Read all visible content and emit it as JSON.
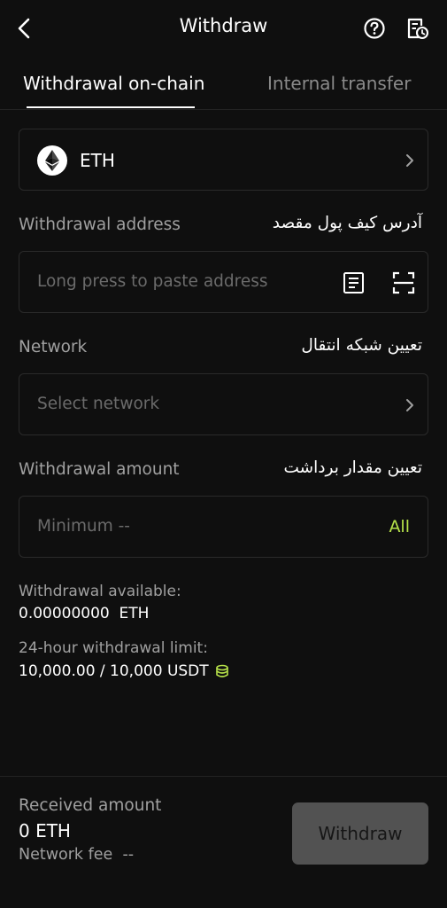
{
  "header": {
    "title": "Withdraw",
    "back_icon": "chevron-left-icon",
    "help_icon": "question-circle-icon",
    "record_icon": "history-document-icon"
  },
  "tabs": [
    {
      "label": "Withdrawal on-chain",
      "active": true
    },
    {
      "label": "Internal transfer",
      "active": false
    }
  ],
  "coin": {
    "name": "ETH",
    "icon": "ethereum-logo-icon"
  },
  "address": {
    "label": "Withdrawal address",
    "label_fa": "آدرس کیف پول مقصد",
    "placeholder": "Long press to paste address"
  },
  "network": {
    "label": "Network",
    "label_fa": "تعیین شبکه انتقال",
    "placeholder": "Select network"
  },
  "amount": {
    "label": "Withdrawal amount",
    "label_fa": "تعیین مقدار برداشت",
    "placeholder": "Minimum --",
    "all_label": "All"
  },
  "available": {
    "label": "Withdrawal available:",
    "value": "0.00000000  ETH"
  },
  "limit": {
    "label": "24-hour withdrawal limit:",
    "value": "10,000.00 / 10,000 USDT"
  },
  "footer": {
    "received_label": "Received amount",
    "received_value": "0 ETH",
    "fee_label": "Network fee",
    "fee_value": "--",
    "withdraw_label": "Withdraw"
  },
  "colors": {
    "background": "#0f0f0f",
    "accent": "#b7e34a",
    "button_disabled": "#525252",
    "muted_text": "#a0a0a0"
  }
}
